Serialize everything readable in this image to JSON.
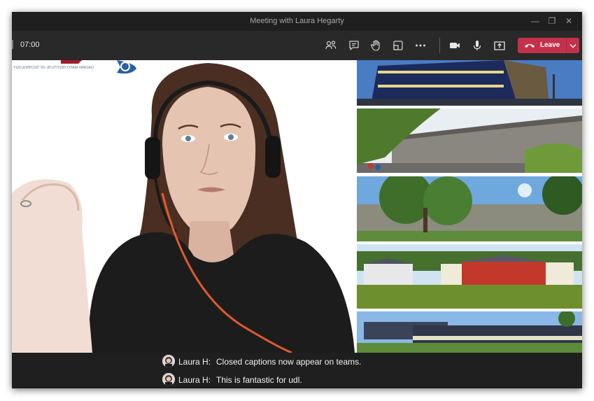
{
  "window": {
    "title": "Meeting with Laura Hegarty"
  },
  "toolbar": {
    "timer": "07:00",
    "leave_label": "Leave",
    "icons": [
      "participants-icon",
      "chat-icon",
      "raise-hand-icon",
      "share-tray-icon",
      "more-options-icon",
      "camera-icon",
      "microphone-icon",
      "share-screen-icon",
      "phone-icon",
      "chevron-down-icon"
    ]
  },
  "video": {
    "logo_text": "GALWAY-MAYO INSTITUTE OF TECHNOLOGY"
  },
  "captions": [
    {
      "speaker": "Laura H:",
      "text": "Closed captions now appear on teams."
    },
    {
      "speaker": "Laura H:",
      "text": "This is fantastic for udl."
    }
  ],
  "colors": {
    "leave": "#c4314b",
    "background": "#292929",
    "titlebar": "#1f1f1f"
  }
}
